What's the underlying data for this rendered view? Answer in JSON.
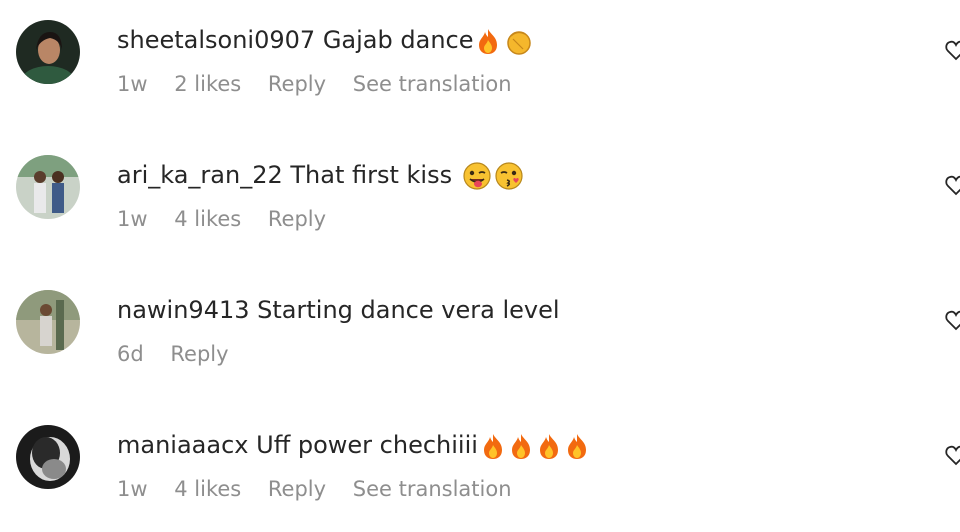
{
  "comments": [
    {
      "username": "sheetalsoni0907",
      "text": "Gajab dance",
      "emojis": [
        "fire-emoji",
        "clap-emoji"
      ],
      "time": "1w",
      "likes": "2 likes",
      "reply": "Reply",
      "translation": "See translation"
    },
    {
      "username": "ari_ka_ran_22",
      "text": "That first kiss",
      "emojis": [
        "tongue-face-emoji",
        "wink-kiss-face-emoji"
      ],
      "time": "1w",
      "likes": "4 likes",
      "reply": "Reply"
    },
    {
      "username": "nawin9413",
      "text": "Starting dance vera level",
      "emojis": [],
      "time": "6d",
      "reply": "Reply"
    },
    {
      "username": "maniaaacx",
      "text": "Uff power chechiiii",
      "emojis": [
        "fire-emoji",
        "fire-emoji",
        "fire-emoji",
        "fire-emoji"
      ],
      "time": "1w",
      "likes": "4 likes",
      "reply": "Reply",
      "translation": "See translation"
    }
  ],
  "colors": {
    "text": "#262626",
    "secondary": "#8e8e8e"
  }
}
